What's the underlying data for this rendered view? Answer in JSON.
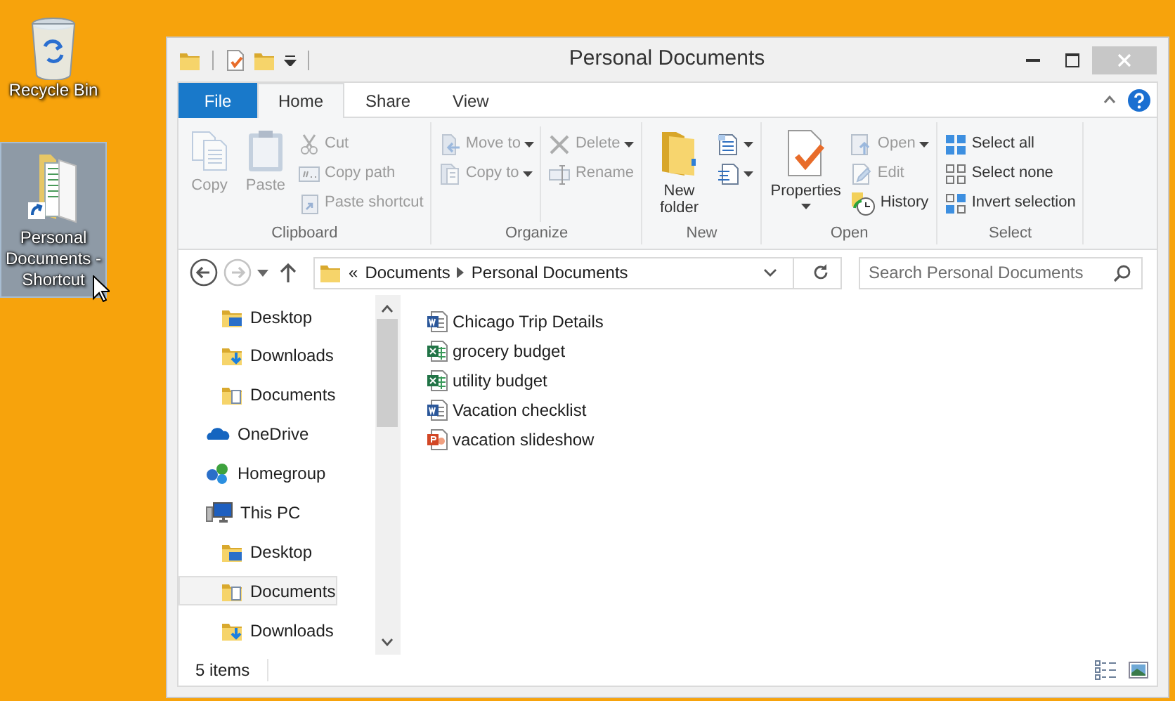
{
  "desktop_icons": [
    {
      "label": "Recycle Bin",
      "kind": "bin",
      "selected": false
    },
    {
      "label": "Personal Documents - Shortcut",
      "kind": "shortcut",
      "selected": true
    }
  ],
  "window": {
    "title": "Personal Documents"
  },
  "ribbon": {
    "tabs": [
      {
        "label": "File",
        "kind": "file",
        "selected": false
      },
      {
        "label": "Home",
        "kind": "tab",
        "selected": true
      },
      {
        "label": "Share",
        "kind": "tab",
        "selected": false
      },
      {
        "label": "View",
        "kind": "tab",
        "selected": false
      }
    ],
    "groups": [
      {
        "name": "Clipboard",
        "columns": [
          [
            {
              "label": "Copy",
              "kind": "large",
              "disabled": true
            }
          ],
          [
            {
              "label": "Paste",
              "kind": "large",
              "disabled": true
            }
          ],
          [
            {
              "label": "Cut",
              "kind": "small",
              "disabled": true
            },
            {
              "label": "Copy path",
              "kind": "small",
              "disabled": true
            },
            {
              "label": "Paste shortcut",
              "kind": "small",
              "disabled": true
            }
          ]
        ]
      },
      {
        "name": "Organize",
        "columns": [
          [
            {
              "label": "Move to",
              "kind": "small",
              "disabled": true,
              "menu": true
            },
            {
              "label": "Copy to",
              "kind": "small",
              "disabled": true,
              "menu": true
            }
          ],
          [
            {
              "label": "Delete",
              "kind": "small",
              "disabled": true,
              "menu": true
            },
            {
              "label": "Rename",
              "kind": "small",
              "disabled": true
            }
          ]
        ]
      },
      {
        "name": "New",
        "columns": [
          [
            {
              "label": "New folder",
              "kind": "large",
              "disabled": false
            }
          ],
          [
            {
              "kind": "small",
              "disabled": false,
              "menu": true
            },
            {
              "kind": "small",
              "disabled": false,
              "menu": true
            }
          ]
        ]
      },
      {
        "name": "Open",
        "columns": [
          [
            {
              "label": "Properties",
              "kind": "large",
              "disabled": false,
              "menu": true
            }
          ],
          [
            {
              "label": "Open",
              "kind": "small",
              "disabled": true,
              "menu": true
            },
            {
              "label": "Edit",
              "kind": "small",
              "disabled": true
            },
            {
              "label": "History",
              "kind": "small",
              "disabled": false
            }
          ]
        ]
      },
      {
        "name": "Select",
        "columns": [
          [
            {
              "label": "Select all",
              "kind": "small",
              "disabled": false
            },
            {
              "label": "Select none",
              "kind": "small",
              "disabled": false
            },
            {
              "label": "Invert selection",
              "kind": "small",
              "disabled": false
            }
          ]
        ]
      }
    ]
  },
  "address": {
    "overflow": "«",
    "path": [
      "Documents",
      "Personal Documents"
    ]
  },
  "search": {
    "placeholder": "Search Personal Documents"
  },
  "nav_pane": [
    {
      "children": [
        {
          "label": "Desktop",
          "kind": "desktop",
          "selected": false
        },
        {
          "label": "Downloads",
          "kind": "downloads",
          "selected": false
        },
        {
          "label": "Documents",
          "kind": "documents",
          "selected": false
        }
      ]
    },
    {
      "label": "OneDrive",
      "kind": "onedrive",
      "selected": false
    },
    {
      "label": "Homegroup",
      "kind": "homegroup",
      "selected": false
    },
    {
      "label": "This PC",
      "kind": "pc",
      "selected": false,
      "children": [
        {
          "label": "Desktop",
          "kind": "desktop",
          "selected": false
        },
        {
          "label": "Documents",
          "kind": "documents",
          "selected": true
        },
        {
          "label": "Downloads",
          "kind": "downloads",
          "selected": false
        }
      ]
    }
  ],
  "files": [
    {
      "name": "Chicago Trip Details",
      "kind": "word"
    },
    {
      "name": "grocery budget",
      "kind": "excel"
    },
    {
      "name": "utility budget",
      "kind": "excel"
    },
    {
      "name": "Vacation checklist",
      "kind": "word"
    },
    {
      "name": "vacation slideshow",
      "kind": "powerpoint"
    }
  ],
  "status_bar": {
    "item_count": "5 items"
  }
}
